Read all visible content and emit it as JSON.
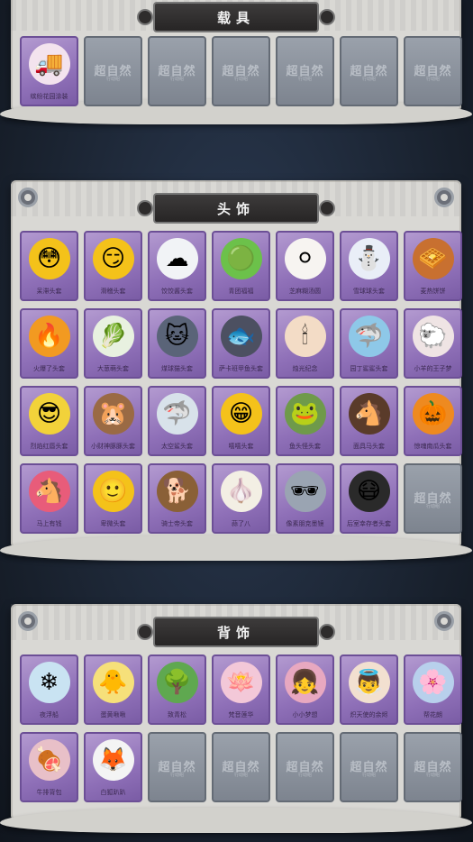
{
  "sections": {
    "vehicles": {
      "title": "载具",
      "items": [
        {
          "name": "缤纷花园涂装",
          "icon": "ice-cream-truck-icon",
          "glyph": "🚚",
          "bg": "#f3e3ee"
        }
      ],
      "empty_count": 6
    },
    "headwear": {
      "title": "头饰",
      "items": [
        {
          "name": "呆滞头套",
          "icon": "dazed-face-icon",
          "glyph": "😳",
          "bg": "#f4c21a"
        },
        {
          "name": "滑稽头套",
          "icon": "smirk-face-icon",
          "glyph": "😏",
          "bg": "#f4c21a"
        },
        {
          "name": "饺饺酱头套",
          "icon": "cloud-dumpling-icon",
          "glyph": "☁",
          "bg": "#f1f3f6"
        },
        {
          "name": "青团福福",
          "icon": "green-dumpling-icon",
          "glyph": "🟢",
          "bg": "#6cc14a"
        },
        {
          "name": "芝麻糊汤圆",
          "icon": "rice-ball-icon",
          "glyph": "⚪",
          "bg": "#f7f4f1"
        },
        {
          "name": "雪球球头套",
          "icon": "snowman-icon",
          "glyph": "⛄",
          "bg": "#e9eef7"
        },
        {
          "name": "麦热饼饼",
          "icon": "waffle-monster-icon",
          "glyph": "🧇",
          "bg": "#c87030"
        },
        {
          "name": "火爆了头套",
          "icon": "fire-spirit-icon",
          "glyph": "🔥",
          "bg": "#f29a21"
        },
        {
          "name": "大葱萌头套",
          "icon": "scallion-icon",
          "glyph": "🥬",
          "bg": "#e8f1e0"
        },
        {
          "name": "煤球猫头套",
          "icon": "cat-head-icon",
          "glyph": "🐱",
          "bg": "#5a6478"
        },
        {
          "name": "萨卡班甲鱼头套",
          "icon": "fish-head-icon",
          "glyph": "🐟",
          "bg": "#4c5061"
        },
        {
          "name": "烛光纪念",
          "icon": "candle-icon",
          "glyph": "🕯",
          "bg": "#f3dcc6"
        },
        {
          "name": "园丁鲨鲨头套",
          "icon": "shark-head-icon",
          "glyph": "🦈",
          "bg": "#8ec8e8"
        },
        {
          "name": "小羊的王子梦",
          "icon": "sheep-crown-icon",
          "glyph": "🐑",
          "bg": "#efe4e4"
        },
        {
          "name": "烈焰红唇头套",
          "icon": "pikachu-head-icon",
          "glyph": "😎",
          "bg": "#f2d23a"
        },
        {
          "name": "小财神豚豚头套",
          "icon": "capybara-head-icon",
          "glyph": "🐹",
          "bg": "#9a6a44"
        },
        {
          "name": "太空鲨头套",
          "icon": "space-shark-icon",
          "glyph": "🦈",
          "bg": "#d8e2ea"
        },
        {
          "name": "嘻嘻头套",
          "icon": "grin-face-icon",
          "glyph": "😁",
          "bg": "#f4c21a"
        },
        {
          "name": "鱼头怪头套",
          "icon": "fish-monster-icon",
          "glyph": "🐸",
          "bg": "#6f9a4a"
        },
        {
          "name": "面具马头套",
          "icon": "horse-head-icon",
          "glyph": "🐴",
          "bg": "#5a3b2a"
        },
        {
          "name": "惊魂南瓜头套",
          "icon": "pumpkin-icon",
          "glyph": "🎃",
          "bg": "#ee8a20"
        },
        {
          "name": "马上有钱",
          "icon": "pink-horse-icon",
          "glyph": "🐴",
          "bg": "#e85c7a"
        },
        {
          "name": "卑微头套",
          "icon": "smile-face-icon",
          "glyph": "🙂",
          "bg": "#f4c21a"
        },
        {
          "name": "骑士帝头套",
          "icon": "dog-head-icon",
          "glyph": "🐕",
          "bg": "#8a6037"
        },
        {
          "name": "蒜了八",
          "icon": "garlic-icon",
          "glyph": "🧄",
          "bg": "#f3efe4"
        },
        {
          "name": "像素朋克墨镜",
          "icon": "pixel-sunglasses-icon",
          "glyph": "🕶",
          "bg": "#9aa4b2"
        },
        {
          "name": "后室幸存者头套",
          "icon": "gas-mask-icon",
          "glyph": "😷",
          "bg": "#2a2a2a"
        }
      ],
      "empty_count": 1
    },
    "backwear": {
      "title": "背饰",
      "items": [
        {
          "name": "夜浮船",
          "icon": "ice-wings-icon",
          "glyph": "❄",
          "bg": "#c9e3f2"
        },
        {
          "name": "蛋黄啾啾",
          "icon": "chick-icon",
          "glyph": "🐥",
          "bg": "#f6e07a"
        },
        {
          "name": "致青松",
          "icon": "pine-bonsai-icon",
          "glyph": "🌳",
          "bg": "#5fa850"
        },
        {
          "name": "梵音莲华",
          "icon": "lotus-doll-icon",
          "glyph": "🪷",
          "bg": "#f3c8d8"
        },
        {
          "name": "小小梦想",
          "icon": "girl-doll-icon",
          "glyph": "👧",
          "bg": "#e8a8c0"
        },
        {
          "name": "炽天使的余烬",
          "icon": "angel-doll-icon",
          "glyph": "👼",
          "bg": "#f2e0d0"
        },
        {
          "name": "帮花朗",
          "icon": "flower-wreath-icon",
          "glyph": "🌸",
          "bg": "#b8d0ec"
        },
        {
          "name": "牛排背包",
          "icon": "steak-backpack-icon",
          "glyph": "🍖",
          "bg": "#e8c0c8"
        },
        {
          "name": "白狐趴趴",
          "icon": "white-fox-icon",
          "glyph": "🦊",
          "bg": "#f4f4f4"
        }
      ],
      "empty_count": 5
    }
  },
  "empty_tile": {
    "watermark": "超自然",
    "watermark_sub": "行动组"
  }
}
